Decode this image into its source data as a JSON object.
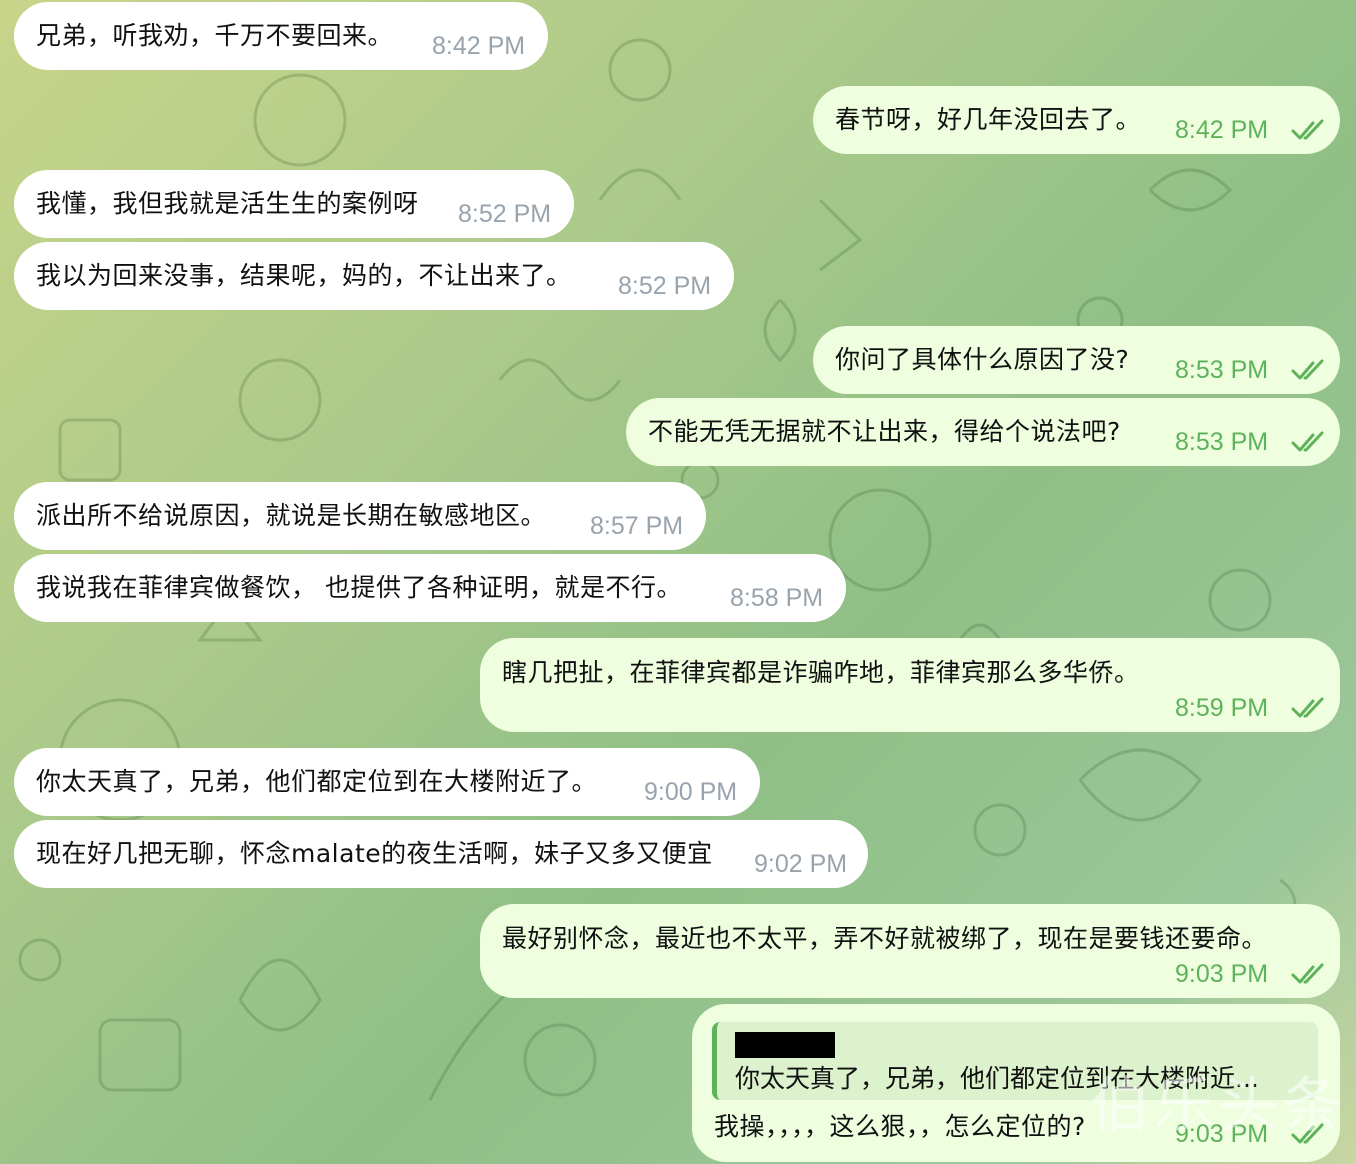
{
  "colors": {
    "incoming_bubble": "#ffffff",
    "outgoing_bubble": "#eefedf",
    "outgoing_time": "#5eb25a",
    "incoming_time": "#98a3ad"
  },
  "messages": [
    {
      "text": "兄弟，听我劝，千万不要回来。",
      "time": "8:42 PM"
    },
    {
      "text": "春节呀，好几年没回去了。",
      "time": "8:42 PM"
    },
    {
      "text": "我懂，我但我就是活生生的案例呀",
      "time": "8:52 PM"
    },
    {
      "text": "我以为回来没事，结果呢，妈的，不让出来了。",
      "time": "8:52 PM"
    },
    {
      "text": "你问了具体什么原因了没?",
      "time": "8:53 PM"
    },
    {
      "text": "不能无凭无据就不让出来，得给个说法吧?",
      "time": "8:53 PM"
    },
    {
      "text": "派出所不给说原因，就说是长期在敏感地区。",
      "time": "8:57 PM"
    },
    {
      "text": "我说我在菲律宾做餐饮， 也提供了各种证明，就是不行。",
      "time": "8:58 PM"
    },
    {
      "text": "瞎几把扯，在菲律宾都是诈骗咋地，菲律宾那么多华侨。",
      "time": "8:59 PM"
    },
    {
      "text": "你太天真了，兄弟，他们都定位到在大楼附近了。",
      "time": "9:00 PM"
    },
    {
      "text": "现在好几把无聊，怀念malate的夜生活啊，妹子又多又便宜",
      "time": "9:02 PM"
    },
    {
      "text": "最好别怀念，最近也不太平，弄不好就被绑了，现在是要钱还要命。",
      "time": "9:03 PM"
    },
    {
      "text": "我操，，，，这么狠，，怎么定位的?",
      "time": "9:03 PM",
      "reply_quote": "你太天真了，兄弟，他们都定位到在大楼附近..."
    }
  ],
  "watermark": "伯乐头条"
}
